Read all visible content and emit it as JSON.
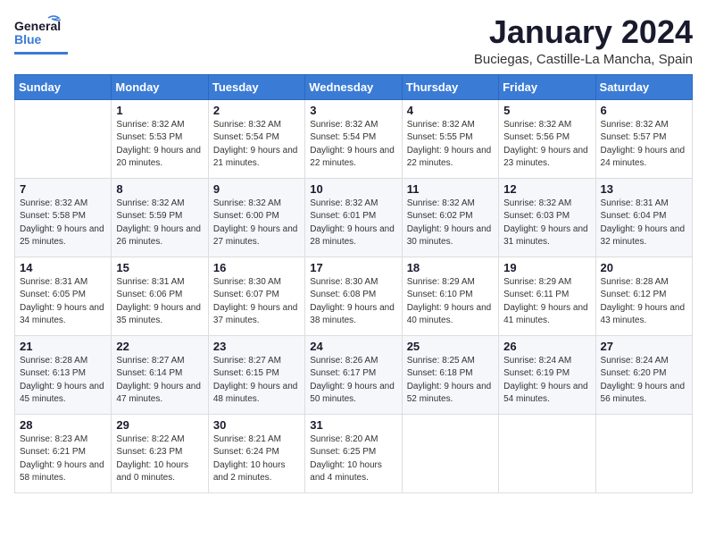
{
  "header": {
    "logo_general": "General",
    "logo_blue": "Blue",
    "month": "January 2024",
    "location": "Buciegas, Castille-La Mancha, Spain"
  },
  "weekdays": [
    "Sunday",
    "Monday",
    "Tuesday",
    "Wednesday",
    "Thursday",
    "Friday",
    "Saturday"
  ],
  "weeks": [
    [
      {
        "day": "",
        "sunrise": "",
        "sunset": "",
        "daylight": ""
      },
      {
        "day": "1",
        "sunrise": "Sunrise: 8:32 AM",
        "sunset": "Sunset: 5:53 PM",
        "daylight": "Daylight: 9 hours and 20 minutes."
      },
      {
        "day": "2",
        "sunrise": "Sunrise: 8:32 AM",
        "sunset": "Sunset: 5:54 PM",
        "daylight": "Daylight: 9 hours and 21 minutes."
      },
      {
        "day": "3",
        "sunrise": "Sunrise: 8:32 AM",
        "sunset": "Sunset: 5:54 PM",
        "daylight": "Daylight: 9 hours and 22 minutes."
      },
      {
        "day": "4",
        "sunrise": "Sunrise: 8:32 AM",
        "sunset": "Sunset: 5:55 PM",
        "daylight": "Daylight: 9 hours and 22 minutes."
      },
      {
        "day": "5",
        "sunrise": "Sunrise: 8:32 AM",
        "sunset": "Sunset: 5:56 PM",
        "daylight": "Daylight: 9 hours and 23 minutes."
      },
      {
        "day": "6",
        "sunrise": "Sunrise: 8:32 AM",
        "sunset": "Sunset: 5:57 PM",
        "daylight": "Daylight: 9 hours and 24 minutes."
      }
    ],
    [
      {
        "day": "7",
        "sunrise": "Sunrise: 8:32 AM",
        "sunset": "Sunset: 5:58 PM",
        "daylight": "Daylight: 9 hours and 25 minutes."
      },
      {
        "day": "8",
        "sunrise": "Sunrise: 8:32 AM",
        "sunset": "Sunset: 5:59 PM",
        "daylight": "Daylight: 9 hours and 26 minutes."
      },
      {
        "day": "9",
        "sunrise": "Sunrise: 8:32 AM",
        "sunset": "Sunset: 6:00 PM",
        "daylight": "Daylight: 9 hours and 27 minutes."
      },
      {
        "day": "10",
        "sunrise": "Sunrise: 8:32 AM",
        "sunset": "Sunset: 6:01 PM",
        "daylight": "Daylight: 9 hours and 28 minutes."
      },
      {
        "day": "11",
        "sunrise": "Sunrise: 8:32 AM",
        "sunset": "Sunset: 6:02 PM",
        "daylight": "Daylight: 9 hours and 30 minutes."
      },
      {
        "day": "12",
        "sunrise": "Sunrise: 8:32 AM",
        "sunset": "Sunset: 6:03 PM",
        "daylight": "Daylight: 9 hours and 31 minutes."
      },
      {
        "day": "13",
        "sunrise": "Sunrise: 8:31 AM",
        "sunset": "Sunset: 6:04 PM",
        "daylight": "Daylight: 9 hours and 32 minutes."
      }
    ],
    [
      {
        "day": "14",
        "sunrise": "Sunrise: 8:31 AM",
        "sunset": "Sunset: 6:05 PM",
        "daylight": "Daylight: 9 hours and 34 minutes."
      },
      {
        "day": "15",
        "sunrise": "Sunrise: 8:31 AM",
        "sunset": "Sunset: 6:06 PM",
        "daylight": "Daylight: 9 hours and 35 minutes."
      },
      {
        "day": "16",
        "sunrise": "Sunrise: 8:30 AM",
        "sunset": "Sunset: 6:07 PM",
        "daylight": "Daylight: 9 hours and 37 minutes."
      },
      {
        "day": "17",
        "sunrise": "Sunrise: 8:30 AM",
        "sunset": "Sunset: 6:08 PM",
        "daylight": "Daylight: 9 hours and 38 minutes."
      },
      {
        "day": "18",
        "sunrise": "Sunrise: 8:29 AM",
        "sunset": "Sunset: 6:10 PM",
        "daylight": "Daylight: 9 hours and 40 minutes."
      },
      {
        "day": "19",
        "sunrise": "Sunrise: 8:29 AM",
        "sunset": "Sunset: 6:11 PM",
        "daylight": "Daylight: 9 hours and 41 minutes."
      },
      {
        "day": "20",
        "sunrise": "Sunrise: 8:28 AM",
        "sunset": "Sunset: 6:12 PM",
        "daylight": "Daylight: 9 hours and 43 minutes."
      }
    ],
    [
      {
        "day": "21",
        "sunrise": "Sunrise: 8:28 AM",
        "sunset": "Sunset: 6:13 PM",
        "daylight": "Daylight: 9 hours and 45 minutes."
      },
      {
        "day": "22",
        "sunrise": "Sunrise: 8:27 AM",
        "sunset": "Sunset: 6:14 PM",
        "daylight": "Daylight: 9 hours and 47 minutes."
      },
      {
        "day": "23",
        "sunrise": "Sunrise: 8:27 AM",
        "sunset": "Sunset: 6:15 PM",
        "daylight": "Daylight: 9 hours and 48 minutes."
      },
      {
        "day": "24",
        "sunrise": "Sunrise: 8:26 AM",
        "sunset": "Sunset: 6:17 PM",
        "daylight": "Daylight: 9 hours and 50 minutes."
      },
      {
        "day": "25",
        "sunrise": "Sunrise: 8:25 AM",
        "sunset": "Sunset: 6:18 PM",
        "daylight": "Daylight: 9 hours and 52 minutes."
      },
      {
        "day": "26",
        "sunrise": "Sunrise: 8:24 AM",
        "sunset": "Sunset: 6:19 PM",
        "daylight": "Daylight: 9 hours and 54 minutes."
      },
      {
        "day": "27",
        "sunrise": "Sunrise: 8:24 AM",
        "sunset": "Sunset: 6:20 PM",
        "daylight": "Daylight: 9 hours and 56 minutes."
      }
    ],
    [
      {
        "day": "28",
        "sunrise": "Sunrise: 8:23 AM",
        "sunset": "Sunset: 6:21 PM",
        "daylight": "Daylight: 9 hours and 58 minutes."
      },
      {
        "day": "29",
        "sunrise": "Sunrise: 8:22 AM",
        "sunset": "Sunset: 6:23 PM",
        "daylight": "Daylight: 10 hours and 0 minutes."
      },
      {
        "day": "30",
        "sunrise": "Sunrise: 8:21 AM",
        "sunset": "Sunset: 6:24 PM",
        "daylight": "Daylight: 10 hours and 2 minutes."
      },
      {
        "day": "31",
        "sunrise": "Sunrise: 8:20 AM",
        "sunset": "Sunset: 6:25 PM",
        "daylight": "Daylight: 10 hours and 4 minutes."
      },
      {
        "day": "",
        "sunrise": "",
        "sunset": "",
        "daylight": ""
      },
      {
        "day": "",
        "sunrise": "",
        "sunset": "",
        "daylight": ""
      },
      {
        "day": "",
        "sunrise": "",
        "sunset": "",
        "daylight": ""
      }
    ]
  ]
}
